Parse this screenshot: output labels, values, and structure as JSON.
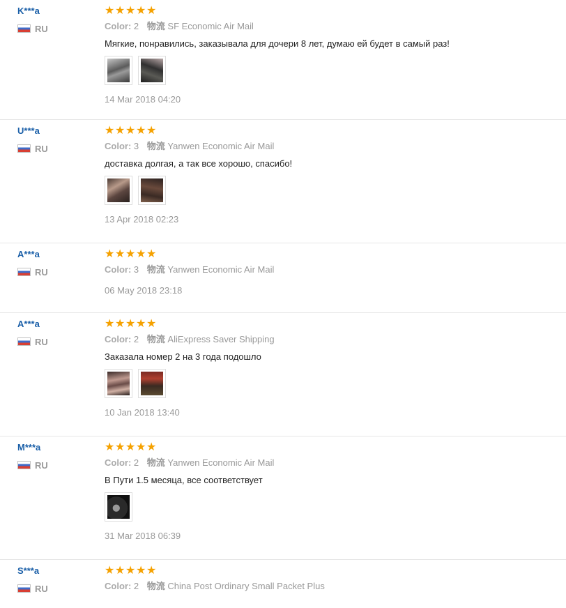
{
  "reviews": [
    {
      "username": "K***a",
      "country": "RU",
      "stars": 5,
      "color_label": "Color:",
      "color_value": "2",
      "logistics_label": "物流",
      "logistics_value": "SF Economic Air Mail",
      "comment": "Мягкие, понравились, заказывала для дочери 8 лет, думаю ей будет в самый раз!",
      "photos": [
        "photo-1",
        "photo-2"
      ],
      "date": "14 Mar 2018 04:20"
    },
    {
      "username": "U***a",
      "country": "RU",
      "stars": 5,
      "color_label": "Color:",
      "color_value": "3",
      "logistics_label": "物流",
      "logistics_value": "Yanwen Economic Air Mail",
      "comment": "доставка долгая, а так все хорошо, спасибо!",
      "photos": [
        "photo-1",
        "photo-2"
      ],
      "date": "13 Apr 2018 02:23"
    },
    {
      "username": "A***a",
      "country": "RU",
      "stars": 5,
      "color_label": "Color:",
      "color_value": "3",
      "logistics_label": "物流",
      "logistics_value": "Yanwen Economic Air Mail",
      "comment": "",
      "photos": [],
      "date": "06 May 2018 23:18"
    },
    {
      "username": "A***a",
      "country": "RU",
      "stars": 5,
      "color_label": "Color:",
      "color_value": "2",
      "logistics_label": "物流",
      "logistics_value": "AliExpress Saver Shipping",
      "comment": "Заказала номер 2 на 3 года подошло",
      "photos": [
        "photo-1",
        "photo-2"
      ],
      "date": "10 Jan 2018 13:40"
    },
    {
      "username": "M***a",
      "country": "RU",
      "stars": 5,
      "color_label": "Color:",
      "color_value": "2",
      "logistics_label": "物流",
      "logistics_value": "Yanwen Economic Air Mail",
      "comment": "В Пути 1.5 месяца, все соответствует",
      "photos": [
        "photo-1"
      ],
      "date": "31 Mar 2018 06:39"
    },
    {
      "username": "S***a",
      "country": "RU",
      "stars": 5,
      "color_label": "Color:",
      "color_value": "2",
      "logistics_label": "物流",
      "logistics_value": "China Post Ordinary Small Packet Plus",
      "comment": "",
      "photos": [],
      "date": ""
    }
  ],
  "colors": {
    "username": "#1a5fa8",
    "star": "#f5a100",
    "meta": "#999999",
    "divider": "#e6e6e6"
  }
}
